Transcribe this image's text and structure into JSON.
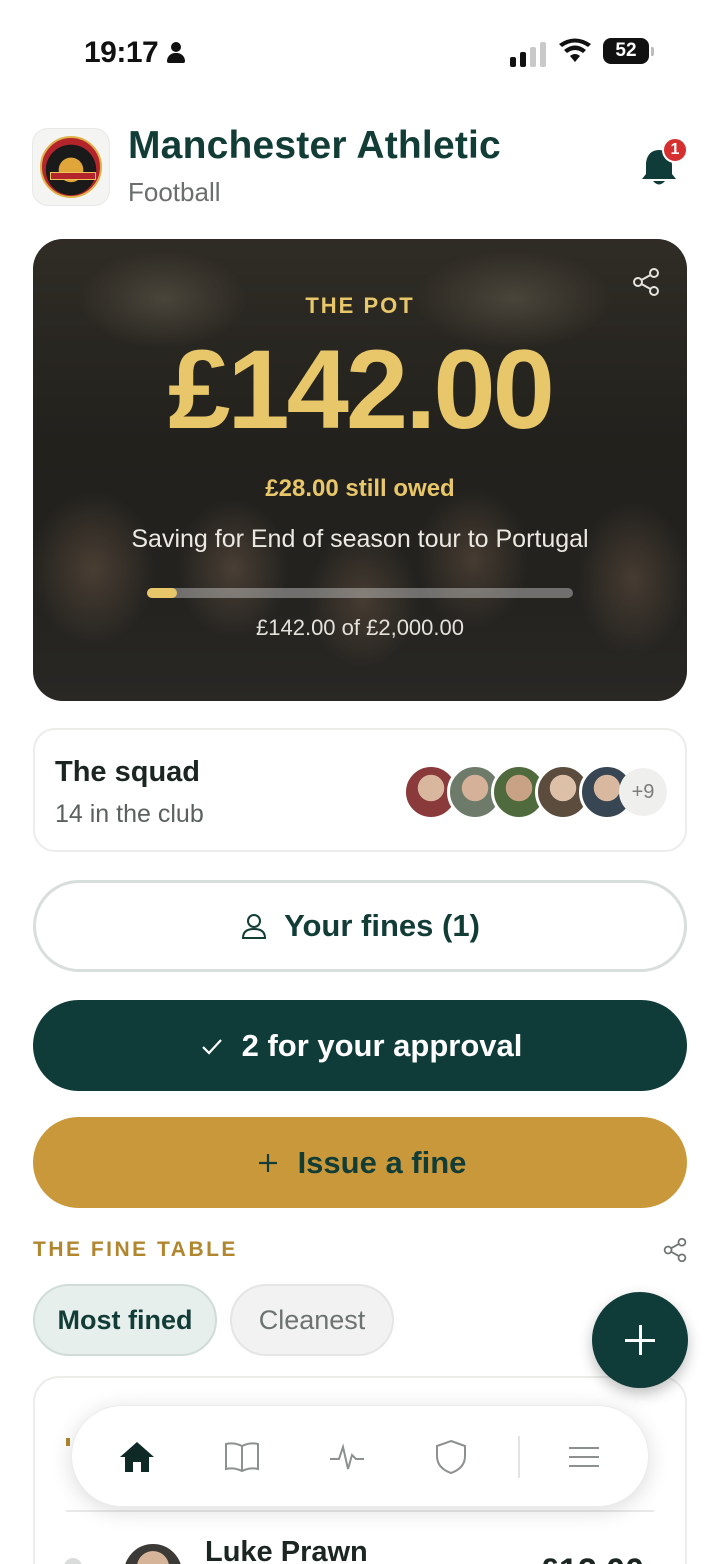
{
  "status_bar": {
    "time": "19:17",
    "battery": "52"
  },
  "header": {
    "club_name": "Manchester Athletic",
    "sport": "Football",
    "notification_count": "1"
  },
  "pot": {
    "label": "THE POT",
    "amount": "£142.00",
    "owed": "£28.00 still owed",
    "saving_for": "Saving for End of season tour to Portugal",
    "progress_fraction": 0.071,
    "target_text": "£142.00 of £2,000.00"
  },
  "squad": {
    "title": "The squad",
    "subtitle": "14 in the club",
    "more_count": "+9"
  },
  "actions": {
    "your_fines": "Your fines (1)",
    "approval": "2 for your approval",
    "issue_fine": "Issue a fine"
  },
  "fine_table": {
    "heading": "THE FINE TABLE",
    "chips": [
      "Most fined",
      "Cleanest"
    ],
    "first_row": {
      "name": "Luke Prawn",
      "amount": "£12.00"
    }
  },
  "tabbar": {
    "items": [
      "home-icon",
      "book-icon",
      "activity-icon",
      "shield-icon",
      "menu-icon"
    ]
  },
  "colors": {
    "brand_dark": "#0f3c38",
    "gold": "#c9983a",
    "pot_gold": "#e8c76a",
    "badge_red": "#d62f2f"
  }
}
